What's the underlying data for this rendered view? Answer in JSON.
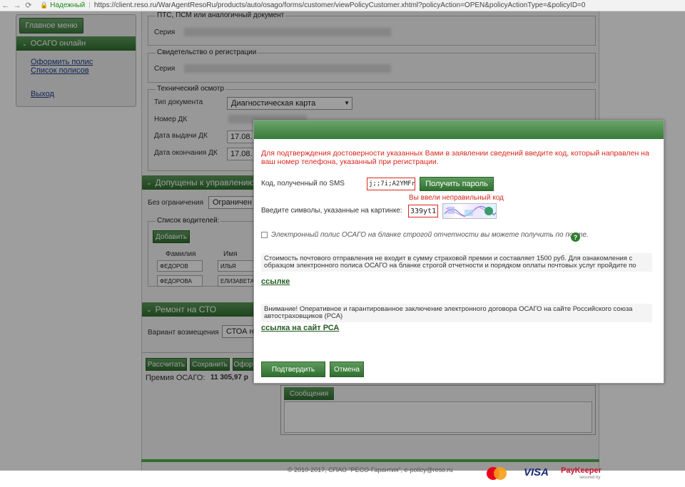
{
  "browser": {
    "secure_label": "Надежный",
    "url": "https://client.reso.ru/WarAgentResoRu/products/auto/osago/forms/customer/viewPolicyCustomer.xhtml?policyAction=OPEN&policyActionType=&policyID=0"
  },
  "sidebar": {
    "main_menu": "Главное меню",
    "section": "ОСАГО онлайн",
    "links": [
      "Оформить полис",
      "Список полисов",
      "Выход"
    ]
  },
  "form": {
    "pts_legend": "ПТС, ПСМ или аналогичный документ",
    "series_label": "Серия",
    "reg_legend": "Свидетельство о регистрации",
    "tech_legend": "Технический осмотр",
    "doc_type_label": "Тип документа",
    "doc_type_value": "Диагностическая карта",
    "dk_number_label": "Номер ДК",
    "issue_date_label": "Дата выдачи ДК",
    "issue_date_value": "17.08.",
    "end_date_label": "Дата окончания ДК",
    "end_date_value": "17.08.",
    "drivers_section": "Допущены к управлению",
    "no_limit_label": "Без ограничения",
    "no_limit_value": "Ограничен",
    "drivers_list_legend": "Список водителей:",
    "add_button": "Добавить",
    "col_surname": "Фамилия",
    "col_name": "Имя",
    "drivers": [
      {
        "surname": "ФЕДОРОВ",
        "name": "ИЛЬЯ"
      },
      {
        "surname": "ФЕДОРОВА",
        "name": "ЕЛИЗАВЕТА"
      }
    ],
    "sto_section": "Ремонт на СТО",
    "variant_label": "Вариант возмещения",
    "variant_value": "СТОА н",
    "calc_button": "Рассчитать",
    "save_button": "Сохранить",
    "issue_button": "Офор",
    "premium_label": "Премия ОСАГО:",
    "premium_value": "11 305,97 р"
  },
  "messages": {
    "tab_label": "Сообщения"
  },
  "footer": {
    "copyright": "© 2010-2017, СПАО \"РЕСО-Гарантия\", e-policy@reso.ru",
    "visa": "VISA",
    "paykeeper": "PayKeeper",
    "paykeeper_sub": "secured by"
  },
  "modal": {
    "warning": "Для подтверждения достоверности указанных Вами в заявлении сведений введите код, который направлен на ваш номер телефона, указанный при регистрации.",
    "sms_label": "Код, полученный по SMS",
    "sms_value": "j;;7i;A2YMFr",
    "get_password_button": "Получить пароль",
    "error": "Вы ввели неправильный код",
    "captcha_label": "Введите символы, указанные на картинке:",
    "captcha_value": "339yt1",
    "checkbox_text": "Электронный полис ОСАГО на бланке строгой отчетности вы можете получить по почте.",
    "postal_info": "Стоимость почтового отправления не входит в сумму страховой премии и составляет 1500 руб. Для ознакомления с образцом электронного полиса ОСАГО на бланке строгой отчетности и порядком оплаты почтовых услуг пройдите по",
    "postal_link": "ссылке",
    "rsa_info": "Внимание! Оперативное и гарантированное заключение электронного договора ОСАГО на сайте Российского союза автостраховщиков (РСА)",
    "rsa_link": "ссылка на сайт РСА",
    "confirm_button": "Подтвердить",
    "cancel_button": "Отмена"
  }
}
